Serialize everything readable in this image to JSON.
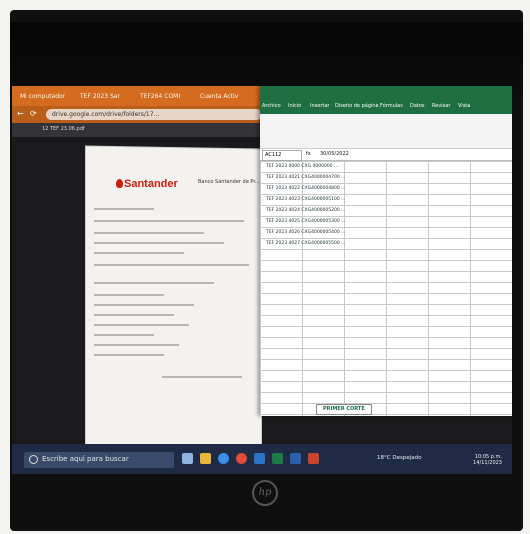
{
  "browser": {
    "tabs": [
      "Mi computador",
      "TEF 2023 Sar",
      "TEF264 COMI",
      "Cuenta Activ"
    ],
    "url": "drive.google.com/drive/folders/17...",
    "pdf_file": "12 TEF 23.06.pdf"
  },
  "pdf": {
    "brand": "Santander",
    "heading": "Banco Santander de Pr... Productos y Aplicac..."
  },
  "excel": {
    "ribbon_tabs": [
      "Archivo",
      "Inicio",
      "Insertar",
      "Diseño de página",
      "Fórmulas",
      "Datos",
      "Revisar",
      "Vista"
    ],
    "name_box": "AC112",
    "formula_value": "30/05/2022",
    "rows": [
      "TEF 2023 4000  CXG 4000000  ...",
      "TEF 2023 4021  CXG4000004700  ...",
      "TEF 2023 4022  CXG4000004800  ...",
      "TEF 2023 4023  CXG4000005100  ...",
      "TEF 2023 4024  CXG4000005200  ...",
      "TEF 2023 4025  CXG4000005300  ...",
      "TEF 2023 4026  CXG4000005400  ...",
      "TEF 2023 4027  CXG4000005500  ..."
    ],
    "sheet_tab": "PRIMER CORTE"
  },
  "taskbar": {
    "search_placeholder": "Escribe aquí para buscar",
    "weather": "18°C Despejado",
    "time": "10:05 p.m.",
    "date": "14/11/2023"
  },
  "laptop_brand": "hp"
}
